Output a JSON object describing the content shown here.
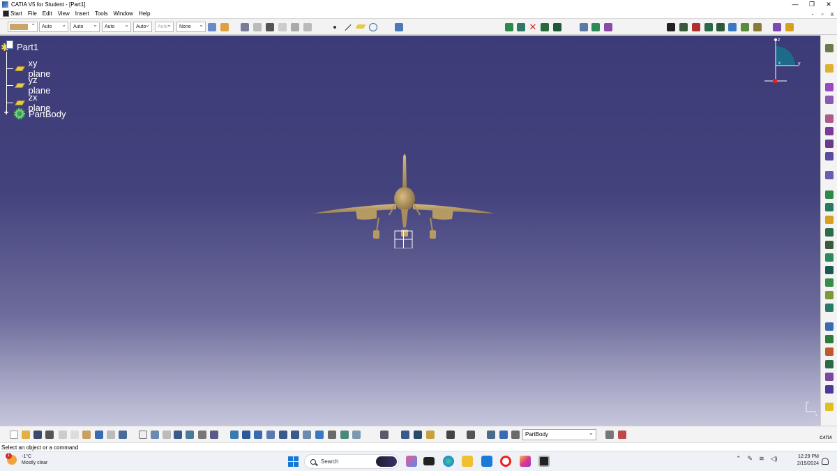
{
  "window": {
    "title": "CATIA V5 for Student - [Part1]",
    "controls": [
      "—",
      "❐",
      "✕"
    ],
    "sub_controls": [
      "-",
      "▫",
      "x"
    ]
  },
  "menu": {
    "items": [
      "Start",
      "File",
      "Edit",
      "View",
      "Insert",
      "Tools",
      "Window",
      "Help"
    ]
  },
  "toolbar": {
    "color_swatch": "#c8a66a",
    "combos": [
      "Auto",
      "Auto",
      "Auto",
      "Auto",
      "Auto"
    ],
    "layer": "None"
  },
  "tree": {
    "root": "Part1",
    "planes": [
      "xy plane",
      "yz plane",
      "zx plane"
    ],
    "body": "PartBody",
    "expand_symbol": "+"
  },
  "compass": {
    "axis_z": "z",
    "axis_y": "y",
    "axis_x": "x"
  },
  "axis_mini": {
    "z": "z",
    "y": "y"
  },
  "bottom": {
    "current_body": "PartBody",
    "catia_label": "CATIA"
  },
  "status": {
    "prompt": "Select an object or a command"
  },
  "taskbar": {
    "weather_temp": "-1°C",
    "weather_desc": "Mostly clear",
    "weather_badge": "1",
    "search_placeholder": "Search",
    "time": "12:29 PM",
    "date": "2/15/2024"
  },
  "colors": {
    "viewport_top": "#3c3b78",
    "viewport_bottom": "#c5c5dc",
    "model": "#b59a63",
    "plane_icon": "#e6c94a"
  }
}
